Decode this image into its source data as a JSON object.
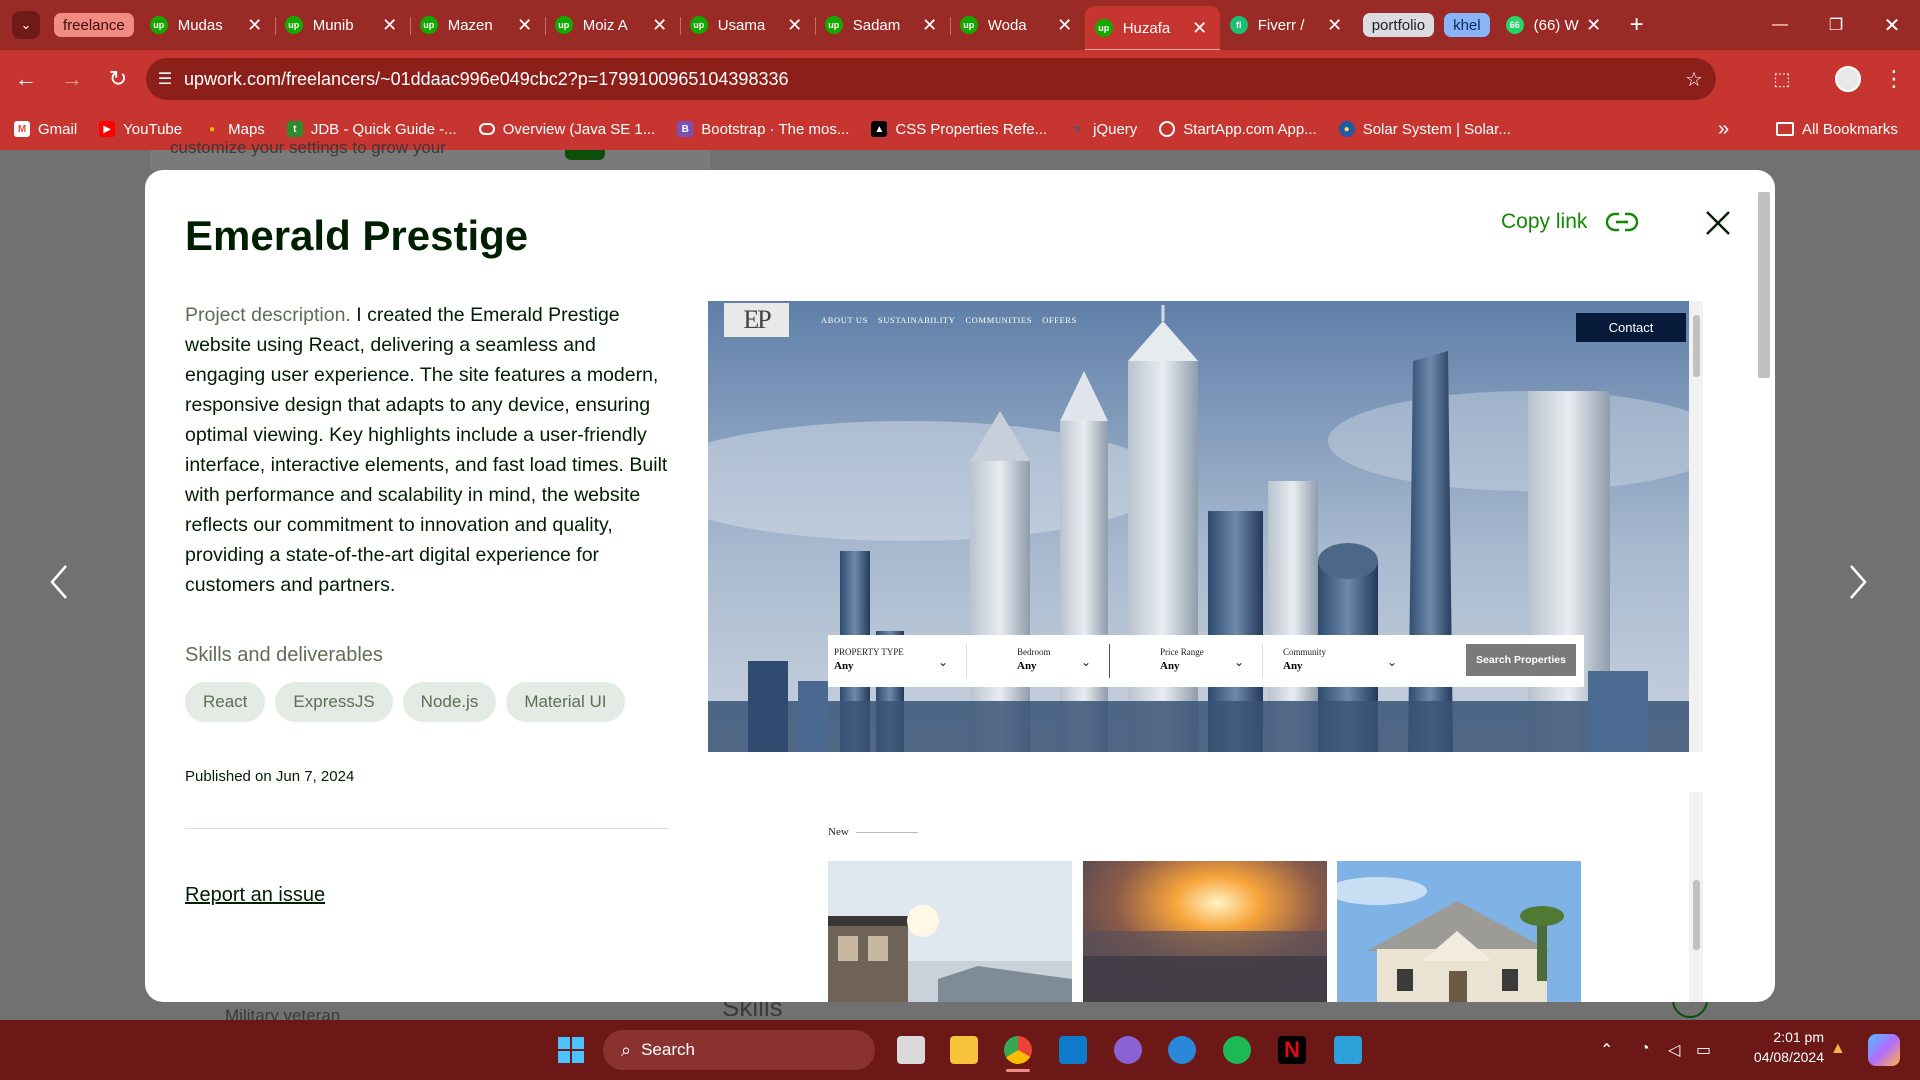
{
  "browser": {
    "tab_groups": [
      {
        "label": "freelance",
        "color": "#f28b82"
      },
      {
        "label": "portfolio",
        "color": "#dadce0"
      },
      {
        "label": "khel",
        "color": "#8ab4f8"
      }
    ],
    "tabs": [
      {
        "title": "Mudas",
        "icon": "upwork-icon"
      },
      {
        "title": "Munib",
        "icon": "upwork-icon"
      },
      {
        "title": "Mazen",
        "icon": "upwork-icon"
      },
      {
        "title": "Moiz A",
        "icon": "upwork-icon"
      },
      {
        "title": "Usama",
        "icon": "upwork-icon"
      },
      {
        "title": "Sadam",
        "icon": "upwork-icon"
      },
      {
        "title": "Woda",
        "icon": "upwork-icon"
      },
      {
        "title": "Huzafa",
        "icon": "upwork-icon",
        "active": true
      },
      {
        "title": "Fiverr /",
        "icon": "fiverr-icon"
      },
      {
        "title": "(66) W",
        "icon": "whatsapp-icon",
        "badge": "66"
      }
    ],
    "url": "upwork.com/freelancers/~01ddaac996e049cbc2?p=1799100965104398336",
    "bookmarks": [
      {
        "label": "Gmail",
        "icon": "gmail-icon"
      },
      {
        "label": "YouTube",
        "icon": "youtube-icon"
      },
      {
        "label": "Maps",
        "icon": "maps-icon"
      },
      {
        "label": "JDB - Quick Guide -...",
        "icon": "jdb-icon"
      },
      {
        "label": "Overview (Java SE 1...",
        "icon": "oracle-icon"
      },
      {
        "label": "Bootstrap · The mos...",
        "icon": "bootstrap-icon"
      },
      {
        "label": "CSS Properties Refe...",
        "icon": "css-icon"
      },
      {
        "label": "jQuery",
        "icon": "jquery-icon"
      },
      {
        "label": "StartApp.com App...",
        "icon": "startapp-icon"
      },
      {
        "label": "Solar System | Solar...",
        "icon": "solar-icon"
      }
    ],
    "all_bookmarks": "All Bookmarks",
    "theme_color": "#c6352f"
  },
  "background_page": {
    "snippet_top": "customize your settings to grow your",
    "snippet_bottom_left": "Military veteran",
    "snippet_bottom_mid": "Skills"
  },
  "modal": {
    "title": "Emerald Prestige",
    "copy_link": "Copy link",
    "description_lead": "Project description.",
    "description": "I created the Emerald Prestige website using React, delivering a seamless and engaging user experience. The site features a modern, responsive design that adapts to any device, ensuring optimal viewing. Key highlights include a user-friendly interface, interactive elements, and fast load times. Built with performance and scalability in mind, the website reflects our commitment to innovation and quality, providing a state-of-the-art digital experience for customers and partners.",
    "skills_heading": "Skills and deliverables",
    "skills": [
      "React",
      "ExpressJS",
      "Node.js",
      "Material UI"
    ],
    "published": "Published on Jun 7, 2024",
    "report": "Report an issue",
    "accent": "#108a00"
  },
  "preview": {
    "logo": "EP",
    "nav": [
      "ABOUT US",
      "SUSTAINABILITY",
      "COMMUNITIES",
      "OFFERS"
    ],
    "contact": "Contact",
    "filters": [
      {
        "label": "PROPERTY TYPE",
        "value": "Any"
      },
      {
        "label": "Bedroom",
        "value": "Any"
      },
      {
        "label": "Price Range",
        "value": "Any"
      },
      {
        "label": "Community",
        "value": "Any"
      }
    ],
    "search_button": "Search Properties",
    "section_label": "New"
  },
  "taskbar": {
    "search": "Search",
    "time": "2:01 pm",
    "date": "04/08/2024"
  }
}
